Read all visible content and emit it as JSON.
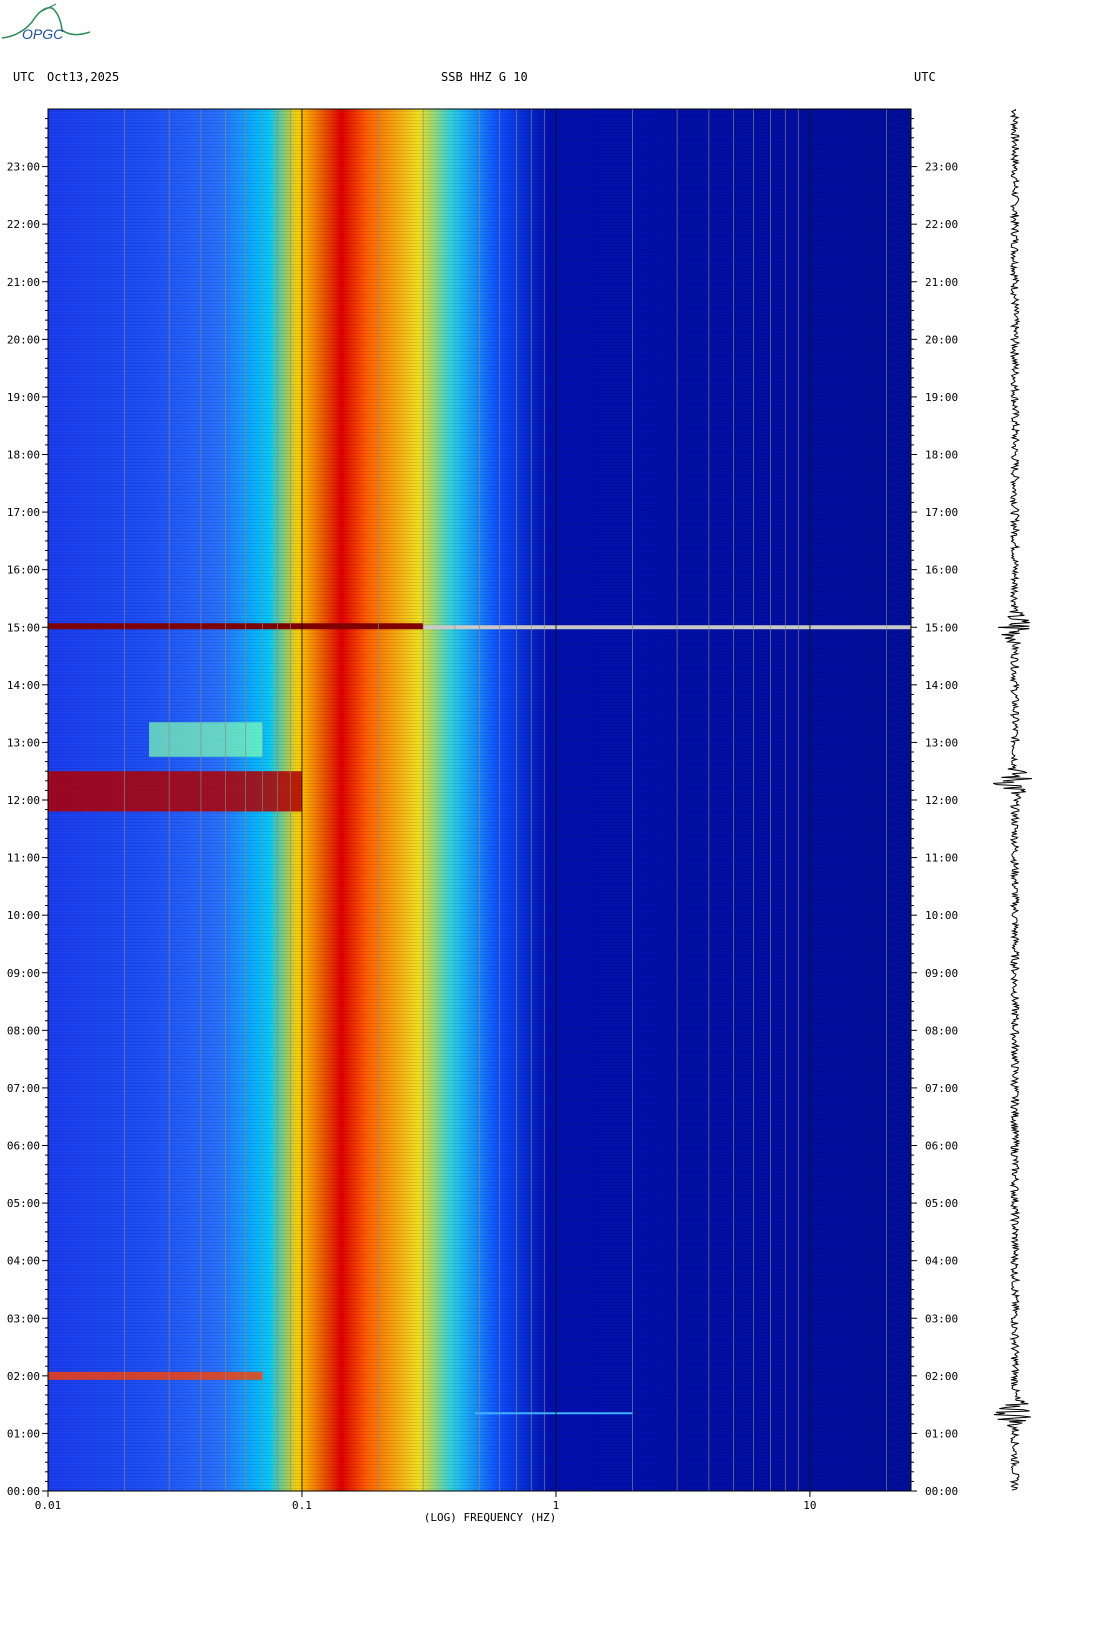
{
  "logo": {
    "text": "OPGC"
  },
  "header": {
    "left_tz": "UTC",
    "date": "Oct13,2025",
    "center": "SSB HHZ G 10",
    "right_tz": "UTC"
  },
  "colors": {
    "background": "#ffffff",
    "gridline": "#8a8a8a",
    "logo": "#2e8b57",
    "trace": "#000000"
  },
  "chart_data": {
    "type": "heatmap",
    "title": "SSB HHZ G 10",
    "xlabel": "(LOG) FREQUENCY (HZ)",
    "ylabel": "",
    "x_scale": "log",
    "xlim": [
      0.01,
      25
    ],
    "x_ticks": [
      {
        "value": 0.01,
        "label": "0.01"
      },
      {
        "value": 0.1,
        "label": "0.1"
      },
      {
        "value": 1,
        "label": "1"
      },
      {
        "value": 10,
        "label": "10"
      }
    ],
    "ylim_hours": [
      0,
      24
    ],
    "y_ticks": [
      "00:00",
      "01:00",
      "02:00",
      "03:00",
      "04:00",
      "05:00",
      "06:00",
      "07:00",
      "08:00",
      "09:00",
      "10:00",
      "11:00",
      "12:00",
      "13:00",
      "14:00",
      "15:00",
      "16:00",
      "17:00",
      "18:00",
      "19:00",
      "20:00",
      "21:00",
      "22:00",
      "23:00"
    ],
    "grid": true,
    "colormap": [
      "#00007f",
      "#0000ff",
      "#00bfff",
      "#7fff7f",
      "#ffff00",
      "#ff7f00",
      "#ff0000",
      "#7f0000"
    ],
    "microseism_band_hz": [
      0.12,
      0.45
    ],
    "events": [
      {
        "time_hours": 1.35,
        "description": "narrow line near 1.5 Hz"
      },
      {
        "time_hours": 12.15,
        "description": "broadband low-frequency energy"
      },
      {
        "time_hours": 15.0,
        "description": "broadband event"
      }
    ],
    "seismogram_events_hours": [
      1.35,
      12.3,
      15.0
    ]
  }
}
